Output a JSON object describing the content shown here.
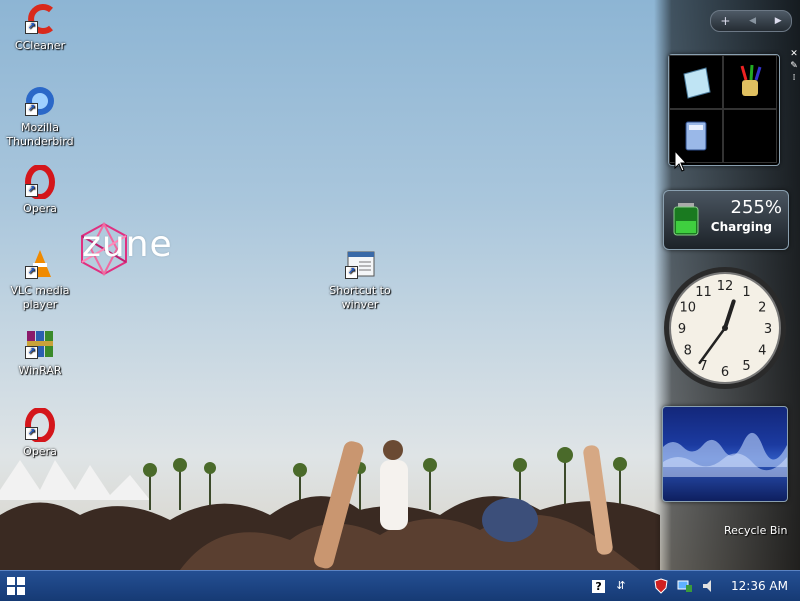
{
  "desktop": {
    "icons": [
      {
        "label": "CCleaner"
      },
      {
        "label": "Mozilla Thunderbird"
      },
      {
        "label": "Opera"
      },
      {
        "label": "VLC media player"
      },
      {
        "label": "WinRAR"
      },
      {
        "label": "Opera"
      },
      {
        "label": "Shortcut to winver"
      }
    ],
    "zune_text": "zune",
    "recycle_bin_label": "Recycle Bin"
  },
  "sidebar": {
    "controls": {
      "add": "+",
      "prev": "◀",
      "next": "▶"
    },
    "battery": {
      "percent": "255%",
      "status": "Charging"
    },
    "clock": {
      "hour": 12,
      "minute": 36
    }
  },
  "taskbar": {
    "time": "12:36 AM",
    "tray_icons": [
      "help-icon",
      "network-icon",
      "security-shield-icon",
      "monitor-icon",
      "speaker-icon"
    ]
  },
  "colors": {
    "taskbar": "#1d4585",
    "sidebar_glass": "#000000"
  }
}
